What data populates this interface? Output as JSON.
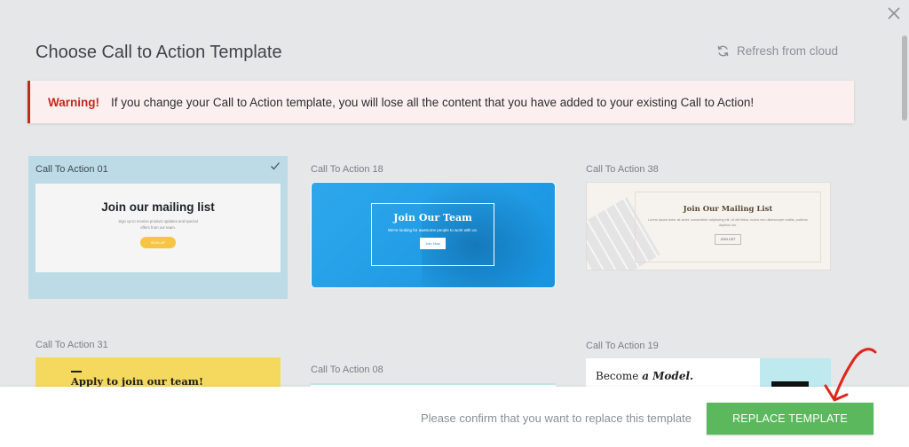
{
  "modal": {
    "title": "Choose Call to Action Template",
    "refresh_label": "Refresh from cloud",
    "close_icon": "close-icon",
    "refresh_icon": "refresh-icon"
  },
  "warning": {
    "label": "Warning!",
    "message": "If you change your Call to Action template, you will lose all the content that you have added to your existing Call to Action!"
  },
  "templates": [
    {
      "name": "Call To Action 01",
      "selected": true,
      "heading": "Join our mailing list",
      "text": "Sign up to receive product updates and special offers from our team.",
      "button": "SIGN UP"
    },
    {
      "name": "Call To Action 18",
      "heading": "Join Our Team",
      "text": "We're looking for awesome people to work with us.",
      "button": "Join Now"
    },
    {
      "name": "Call To Action 38",
      "heading": "Join Our Mailing List",
      "text": "Lorem ipsum dolor sit amet, consectetur adipiscing elit. Ut elit tellus, luctus nec ullamcorper mattis, pulvinar dapibus leo.",
      "button": "JOIN LIST"
    },
    {
      "name": "Call To Action 31",
      "heading": "Apply to join our team!"
    },
    {
      "name": "Call To Action 08"
    },
    {
      "name": "Call To Action 19",
      "heading": "Become",
      "heading_em": "a Model."
    }
  ],
  "footer": {
    "confirm_text": "Please confirm that you want to replace this template",
    "replace_label": "REPLACE TEMPLATE"
  },
  "colors": {
    "accent_green": "#5cb85c",
    "warning_red": "#c5291e",
    "selected_bg": "#bcdbe6"
  }
}
